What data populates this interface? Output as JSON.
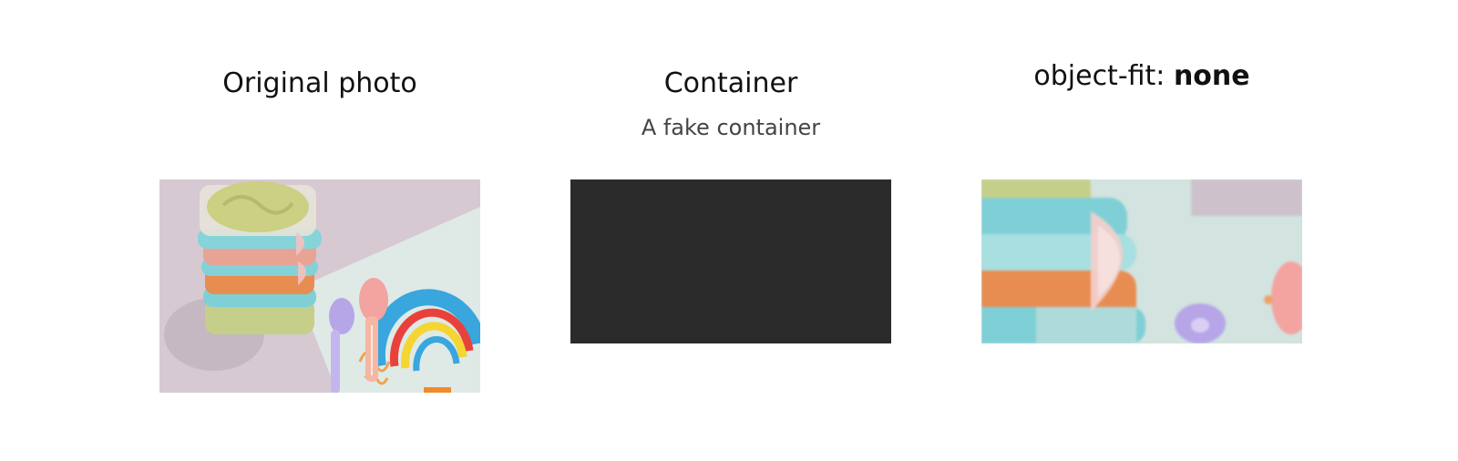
{
  "columns": {
    "original": {
      "title": "Original photo"
    },
    "container": {
      "title": "Container",
      "subtitle": "A fake container"
    },
    "object_fit": {
      "title_prefix": "object-fit: ",
      "title_value": "none"
    }
  },
  "colors": {
    "container_fill": "#2b2b2b",
    "photo_background": "#d4c7cf",
    "napkin": "#dfe9e6",
    "rainbow_blue": "#39a6dd",
    "rainbow_red": "#e8413c",
    "rainbow_yellow": "#f4d532",
    "container_lid": "#7fd0d6",
    "puree": "#c9cf7d",
    "spoon_purple": "#b6a6e8",
    "spoon_pink": "#f3a3a0"
  }
}
